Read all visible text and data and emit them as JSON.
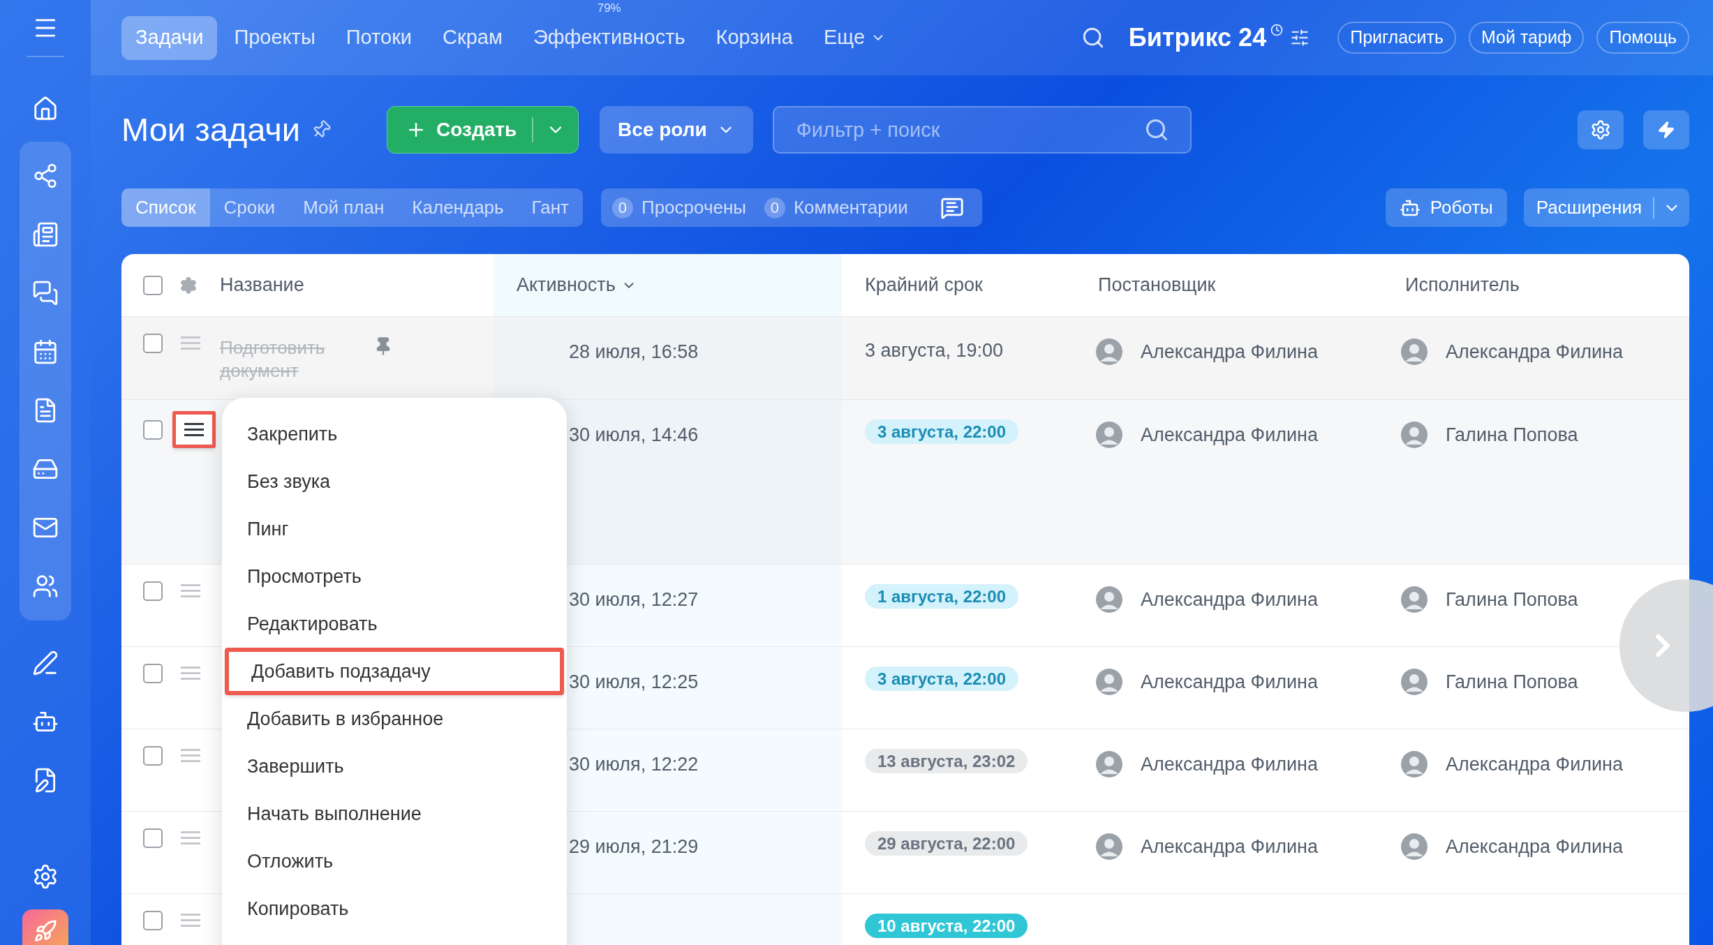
{
  "top_nav": {
    "items": [
      {
        "label": "Задачи",
        "selected": true
      },
      {
        "label": "Проекты",
        "selected": false
      },
      {
        "label": "Потоки",
        "selected": false
      },
      {
        "label": "Скрам",
        "selected": false
      },
      {
        "label": "Эффективность",
        "selected": false,
        "badge": "79%"
      },
      {
        "label": "Корзина",
        "selected": false
      },
      {
        "label": "Еще",
        "selected": false,
        "dropdown": true
      }
    ],
    "brand": "Битрикс 24",
    "buttons": [
      "Пригласить",
      "Мой тариф",
      "Помощь"
    ]
  },
  "page": {
    "title": "Мои задачи",
    "create_button": "Создать",
    "roles_button": "Все роли",
    "search": {
      "placeholder": "Фильтр + поиск"
    }
  },
  "views": [
    {
      "label": "Список",
      "selected": true
    },
    {
      "label": "Сроки",
      "selected": false
    },
    {
      "label": "Мой план",
      "selected": false
    },
    {
      "label": "Календарь",
      "selected": false
    },
    {
      "label": "Гант",
      "selected": false
    }
  ],
  "counters": [
    {
      "count": "0",
      "label": "Просрочены"
    },
    {
      "count": "0",
      "label": "Комментарии"
    }
  ],
  "robots_button": "Роботы",
  "extensions_button": "Расширения",
  "table": {
    "all_checked": false,
    "columns": [
      {
        "label": "Название",
        "sorted": false
      },
      {
        "label": "Активность",
        "sorted": true
      },
      {
        "label": "Крайний срок",
        "sorted": false
      },
      {
        "label": "Постановщик",
        "sorted": false
      },
      {
        "label": "Исполнитель",
        "sorted": false
      }
    ],
    "rows": [
      {
        "kind": "pinned",
        "checked": false,
        "completed": true,
        "handle_highlighted": false,
        "name": "Подготовить документ",
        "activity": "28 июля, 16:58",
        "deadline": {
          "kind": "text",
          "text": "3 августа, 19:00"
        },
        "creator": "Александра Филина",
        "assignee": "Александра Филина"
      },
      {
        "kind": "active",
        "checked": false,
        "handle_highlighted": true,
        "activity": "30 июля, 14:46",
        "deadline": {
          "kind": "badge",
          "text": "3 августа, 22:00",
          "color": "#d3f2fb"
        },
        "creator": "Александра Филина",
        "assignee": "Галина Попова"
      },
      {
        "kind": "normal",
        "checked": false,
        "handle_highlighted": false,
        "activity": "30 июля, 12:27",
        "deadline": {
          "kind": "badge",
          "text": "1 августа, 22:00",
          "color": "#d3f2fb"
        },
        "creator": "Александра Филина",
        "assignee": "Галина Попова"
      },
      {
        "kind": "normal",
        "checked": false,
        "handle_highlighted": false,
        "activity": "30 июля, 12:25",
        "deadline": {
          "kind": "badge",
          "text": "3 августа, 22:00",
          "color": "#d3f2fb"
        },
        "creator": "Александра Филина",
        "assignee": "Галина Попова"
      },
      {
        "kind": "normal",
        "checked": false,
        "handle_highlighted": false,
        "activity": "30 июля, 12:22",
        "deadline": {
          "kind": "badge",
          "text": "13 августа, 23:02",
          "color": "#e8eaec"
        },
        "creator": "Александра Филина",
        "assignee": "Александра Филина"
      },
      {
        "kind": "normal",
        "checked": false,
        "handle_highlighted": false,
        "activity": "29 июля, 21:29",
        "deadline": {
          "kind": "badge",
          "text": "29 августа, 22:00",
          "color": "#e8eaec"
        },
        "creator": "Александра Филина",
        "assignee": "Александра Филина"
      },
      {
        "kind": "normal",
        "checked": false,
        "handle_highlighted": false,
        "deadline": {
          "kind": "badge",
          "text": "10 августа, 22:00",
          "color": "#2fc6d5"
        }
      }
    ]
  },
  "context_menu": {
    "items": [
      {
        "label": "Закрепить",
        "highlighted": false
      },
      {
        "label": "Без звука",
        "highlighted": false
      },
      {
        "label": "Пинг",
        "highlighted": false
      },
      {
        "label": "Просмотреть",
        "highlighted": false
      },
      {
        "label": "Редактировать",
        "highlighted": false
      },
      {
        "label": "Добавить подзадачу",
        "highlighted": true
      },
      {
        "label": "Добавить в избранное",
        "highlighted": false
      },
      {
        "label": "Завершить",
        "highlighted": false
      },
      {
        "label": "Начать выполнение",
        "highlighted": false
      },
      {
        "label": "Отложить",
        "highlighted": false
      },
      {
        "label": "Копировать",
        "highlighted": false
      }
    ]
  }
}
